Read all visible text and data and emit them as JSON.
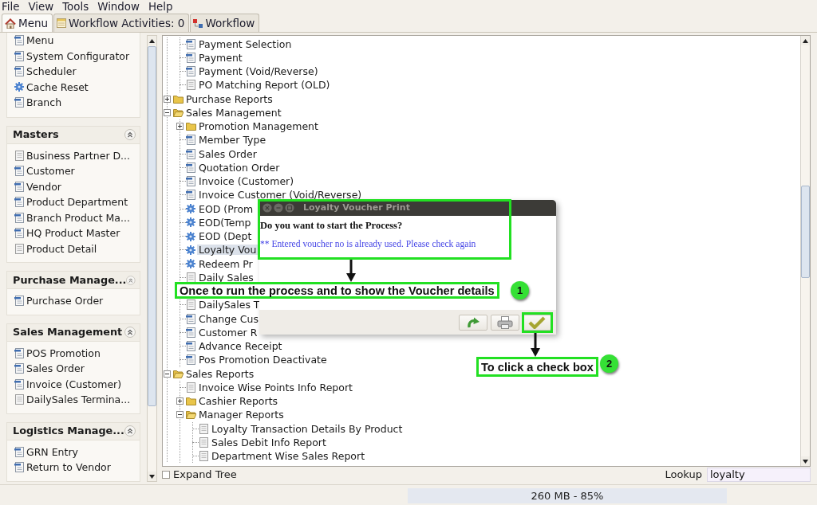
{
  "menu_bar": [
    {
      "label": "File"
    },
    {
      "label": "View"
    },
    {
      "label": "Tools"
    },
    {
      "label": "Window"
    },
    {
      "label": "Help"
    }
  ],
  "tabs": [
    {
      "label": "Menu",
      "kind": "home",
      "selected": true
    },
    {
      "label": "Workflow Activities: 0",
      "kind": "activities",
      "selected": false
    },
    {
      "label": "Workflow",
      "kind": "workflow",
      "selected": false
    }
  ],
  "sidebar": {
    "panels": [
      {
        "items": [
          {
            "label": "Menu",
            "kind": "window"
          },
          {
            "label": "System Configurator",
            "kind": "window"
          },
          {
            "label": "Scheduler",
            "kind": "window"
          },
          {
            "label": "Cache Reset",
            "kind": "process"
          },
          {
            "label": "Branch",
            "kind": "window"
          }
        ]
      },
      {
        "title": "Masters",
        "expanded": true,
        "items": [
          {
            "label": "Business Partner D...",
            "kind": "report"
          },
          {
            "label": "Customer",
            "kind": "window"
          },
          {
            "label": "Vendor",
            "kind": "window"
          },
          {
            "label": "Product Department",
            "kind": "window"
          },
          {
            "label": "Branch Product Ma...",
            "kind": "window"
          },
          {
            "label": "HQ Product Master",
            "kind": "window"
          },
          {
            "label": "Product Detail",
            "kind": "report"
          }
        ]
      },
      {
        "title": "Purchase Manage...",
        "expanded": true,
        "items": [
          {
            "label": "Purchase Order",
            "kind": "window"
          }
        ]
      },
      {
        "title": "Sales Management",
        "expanded": true,
        "items": [
          {
            "label": "POS Promotion",
            "kind": "window"
          },
          {
            "label": "Sales Order",
            "kind": "window"
          },
          {
            "label": "Invoice (Customer)",
            "kind": "window"
          },
          {
            "label": "DailySales Termina...",
            "kind": "report"
          }
        ]
      },
      {
        "title": "Logistics Manage...",
        "expanded": true,
        "items": [
          {
            "label": "GRN Entry",
            "kind": "window"
          },
          {
            "label": "Return to Vendor",
            "kind": "window"
          }
        ]
      }
    ]
  },
  "tree": {
    "nodes": [
      {
        "children": [
          {
            "label": "Payment Selection",
            "kind": "window",
            "selected": false
          },
          {
            "label": "Payment",
            "kind": "window",
            "selected": false
          },
          {
            "label": "Payment (Void/Reverse)",
            "kind": "window",
            "selected": false
          },
          {
            "label": "PO Matching Report (OLD)",
            "kind": "report",
            "selected": false
          }
        ]
      },
      {
        "label": "Purchase Reports",
        "kind": "folder",
        "expanded": false,
        "selected": false
      },
      {
        "label": "Sales Management",
        "kind": "folder",
        "expanded": true,
        "selected": false,
        "children": [
          {
            "label": "Promotion Management",
            "kind": "folder",
            "expanded": false,
            "selected": false
          },
          {
            "label": "Member Type",
            "kind": "window",
            "selected": false
          },
          {
            "label": "Sales Order",
            "kind": "window",
            "selected": false
          },
          {
            "label": "Quotation Order",
            "kind": "window",
            "selected": false
          },
          {
            "label": "Invoice (Customer)",
            "kind": "window",
            "selected": false
          },
          {
            "label": "Invoice Customer (Void/Reverse)",
            "kind": "window",
            "selected": false
          },
          {
            "label": "EOD (Prom",
            "kind": "process",
            "selected": false
          },
          {
            "label": "EOD(Temp",
            "kind": "process",
            "selected": false
          },
          {
            "label": "EOD (Dept",
            "kind": "process",
            "selected": false
          },
          {
            "label": "Loyalty Vou",
            "kind": "process",
            "selected": true
          },
          {
            "label": "Redeem Pr",
            "kind": "process",
            "selected": false
          },
          {
            "label": "Daily Sales",
            "kind": "report",
            "selected": false
          },
          {
            "label": "DailySales T",
            "kind": "report",
            "selected": false
          },
          {
            "label": "Change Cus",
            "kind": "window",
            "selected": false
          },
          {
            "label": "Customer R",
            "kind": "window",
            "selected": false
          },
          {
            "label": "Advance Receipt",
            "kind": "window",
            "selected": false
          },
          {
            "label": "Pos Promotion Deactivate",
            "kind": "window",
            "selected": false
          }
        ]
      },
      {
        "label": "Sales Reports",
        "kind": "folder",
        "expanded": true,
        "selected": false,
        "children": [
          {
            "label": "Invoice Wise Points Info Report",
            "kind": "report",
            "selected": false
          },
          {
            "label": "Cashier Reports",
            "kind": "folder",
            "expanded": false,
            "selected": false
          },
          {
            "label": "Manager Reports",
            "kind": "folder",
            "expanded": true,
            "selected": false,
            "children": [
              {
                "label": "Loyalty Transaction Details By Product",
                "kind": "report",
                "selected": false
              },
              {
                "label": "Sales Debit Info Report",
                "kind": "report",
                "selected": false
              },
              {
                "label": "Department Wise Sales Report",
                "kind": "report",
                "selected": false
              }
            ]
          }
        ]
      }
    ]
  },
  "expand_tree": {
    "label": "Expand Tree",
    "checked": false
  },
  "lookup": {
    "label": "Lookup",
    "value": "loyalty"
  },
  "status_bar": {
    "memory": "260 MB - 85%"
  },
  "dialog": {
    "title": "Loyalty Voucher Print",
    "question": "Do you want to start the Process?",
    "message": "** Entered voucher no is already used. Please check again",
    "buttons": [
      {
        "kind": "redo"
      },
      {
        "kind": "print"
      },
      {
        "kind": "ok"
      }
    ]
  },
  "annotations": [
    {
      "text": "Once to run the process and to show the Voucher details",
      "step": "1"
    },
    {
      "text": "To click a check box",
      "step": "2"
    }
  ]
}
